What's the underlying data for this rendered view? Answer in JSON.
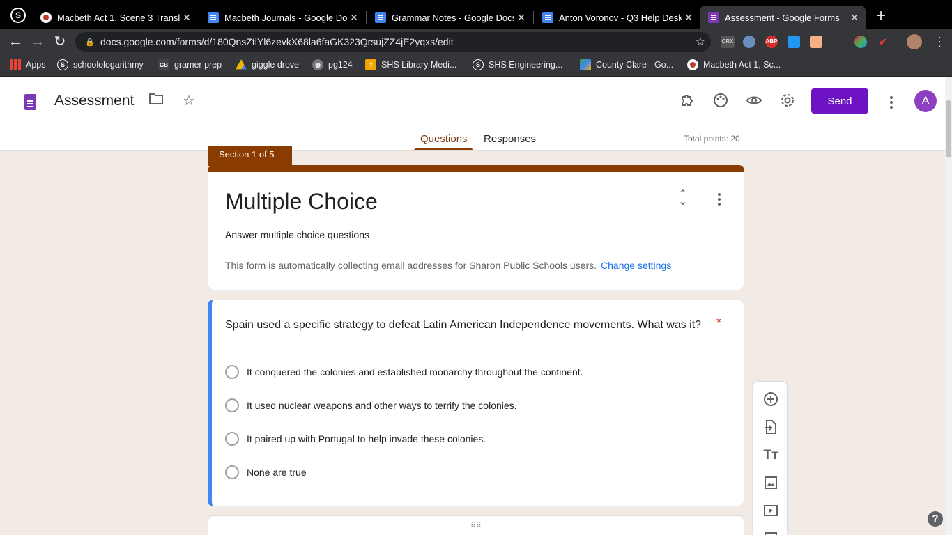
{
  "browser": {
    "tabs": [
      {
        "title": "Macbeth Act 1, Scene 3 Transla",
        "icon": "red-circle-icon"
      },
      {
        "title": "Macbeth Journals - Google Do",
        "icon": "docs-icon"
      },
      {
        "title": "Grammar Notes - Google Docs",
        "icon": "docs-icon"
      },
      {
        "title": "Anton Voronov - Q3 Help Desk",
        "icon": "docs-icon"
      },
      {
        "title": "Assessment - Google Forms",
        "icon": "forms-icon"
      }
    ],
    "new_tab": "+",
    "url": "docs.google.com/forms/d/180QnsZtiYl6zevkX68la6faGK323QrsujZZ4jE2yqxs/edit",
    "extensions": [
      "CRX",
      "ABP"
    ],
    "bookmarks": [
      {
        "label": "Apps",
        "icon": "apps-grid-icon"
      },
      {
        "label": "schoolologarithmy",
        "icon": "schoology-icon"
      },
      {
        "label": "gramer prep",
        "icon": "gb-icon"
      },
      {
        "label": "giggle drove",
        "icon": "drive-icon"
      },
      {
        "label": "pg124",
        "icon": "globe-icon"
      },
      {
        "label": "SHS Library Medi...",
        "icon": "library-icon"
      },
      {
        "label": "SHS Engineering...",
        "icon": "schoology-icon"
      },
      {
        "label": "County Clare - Go...",
        "icon": "maps-icon"
      },
      {
        "label": "Macbeth Act 1, Sc...",
        "icon": "red-circle-icon"
      }
    ]
  },
  "form_header": {
    "title": "Assessment",
    "send_label": "Send",
    "avatar_letter": "A",
    "tabs": {
      "questions": "Questions",
      "responses": "Responses"
    },
    "total_points": "Total points: 20"
  },
  "section": {
    "tab_label": "Section 1 of 5",
    "title": "Multiple Choice",
    "description": "Answer multiple choice questions",
    "email_note": "This form is automatically collecting email addresses for Sharon Public Schools users.",
    "change_settings": "Change settings"
  },
  "question": {
    "text": "Spain used a specific strategy to defeat Latin American Independence movements. What was it?",
    "required_marker": "*",
    "options": [
      "It conquered the colonies and established monarchy throughout the continent.",
      "It used nuclear weapons and other ways to terrify the colonies.",
      "It paired up with Portugal to help invade these colonies.",
      "None are true"
    ]
  },
  "help_label": "?",
  "colors": {
    "theme": "#8a3b00",
    "background": "#f2ebe5",
    "send": "#6e13c4",
    "active_question_border": "#4285f4"
  }
}
